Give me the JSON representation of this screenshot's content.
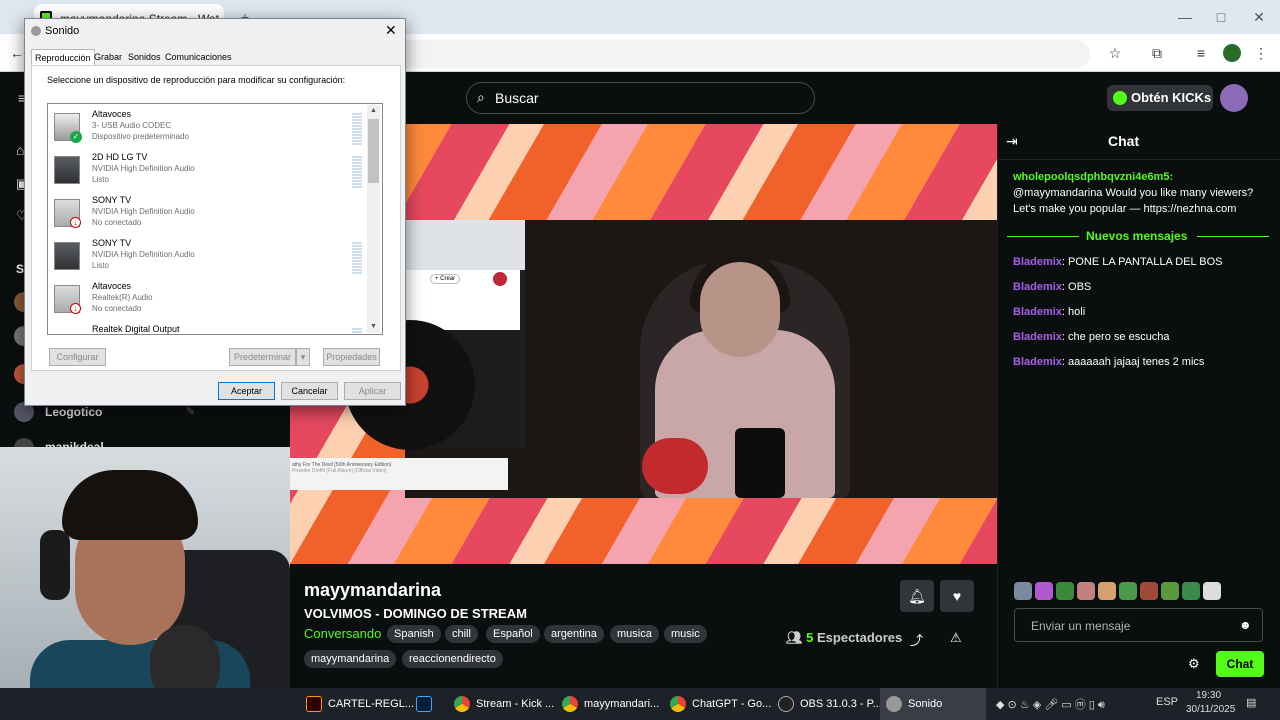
{
  "browser": {
    "tab_title": "mayymandarina Stream - Wat",
    "new_tab": "+",
    "window_controls": [
      "—",
      "□",
      "✕"
    ]
  },
  "kick": {
    "search_placeholder": "Buscar",
    "kicks_button": "Obtén KICKs",
    "sidebar": {
      "section_letter": "S",
      "visible_channels": [
        "Leogotico",
        "manikdeal"
      ]
    }
  },
  "stream": {
    "streamer": "mayymandarina",
    "title": "VOLVIMOS - DOMINGO DE STREAM",
    "category": "Conversando",
    "tags": [
      "Spanish",
      "chill",
      "Español",
      "argentina",
      "musica",
      "music",
      "mayymandarina",
      "reaccionendirecto"
    ],
    "viewers_count": "5",
    "viewers_label": "Espectadores"
  },
  "embedded": {
    "yt_title": "athy For The Devil (50th Anniversary Edition)",
    "yt_sub": "Provoke Dreffit (Full Album) [Official Video]",
    "create_label": "+ Crear"
  },
  "chat": {
    "title": "Chat",
    "first_user": "wholepoolqsdphbqvzni4e6m5:",
    "first_text": "@mayymandarina Would you like many viewers? Let's make you popular — https://nezhna.com",
    "divider": "Nuevos mensajes",
    "messages": [
      {
        "user": "Blademix",
        "text": ": PONE LA PANTALLA DEL BOS"
      },
      {
        "user": "Blademix",
        "text": ": OBS"
      },
      {
        "user": "Blademix",
        "text": ": holi"
      },
      {
        "user": "Blademix",
        "text": ": che pero se escucha"
      },
      {
        "user": "Blademix",
        "text": ": aaaaaah jajaaj tenes 2 mics"
      }
    ],
    "input_placeholder": "Enviar un mensaje",
    "send_label": "Chat"
  },
  "sound_dialog": {
    "title": "Sonido",
    "tabs": [
      "Reproducción",
      "Grabar",
      "Sonidos",
      "Comunicaciones"
    ],
    "instruction": "Seleccione un dispositivo de reproducción para modificar su configuración:",
    "devices": [
      {
        "name": "Altavoces",
        "driver": "3- USB Audio CODEC",
        "status": "Dispositivo predeterminado",
        "badge": "ok"
      },
      {
        "name": "2D HD LG TV",
        "driver": "NVIDIA High Definition Audio",
        "status": "Listo",
        "badge": ""
      },
      {
        "name": "SONY TV",
        "driver": "NVIDIA High Definition Audio",
        "status": "No conectado",
        "badge": "down"
      },
      {
        "name": "SONY TV",
        "driver": "NVIDIA High Definition Audio",
        "status": "Listo",
        "badge": ""
      },
      {
        "name": "Altavoces",
        "driver": "Realtek(R) Audio",
        "status": "No conectado",
        "badge": "down"
      },
      {
        "name": "Realtek Digital Output",
        "driver": "",
        "status": "",
        "badge": ""
      }
    ],
    "btn_configure": "Configurar",
    "btn_default": "Predeterminar",
    "btn_properties": "Propiedades",
    "btn_accept": "Aceptar",
    "btn_cancel": "Cancelar",
    "btn_apply": "Aplicar"
  },
  "taskbar": {
    "items": [
      "CARTEL-REGL...",
      "",
      "Stream - Kick ...",
      "mayymandari...",
      "ChatGPT - Go...",
      "OBS 31.0.3 - P...",
      "Sonido"
    ],
    "lang": "ESP",
    "time": "19:30",
    "date": "30/11/2025"
  },
  "colors": {
    "kick_green": "#53fc18",
    "chat_user_purple": "#a560e8",
    "background": "#0b0e0f"
  }
}
